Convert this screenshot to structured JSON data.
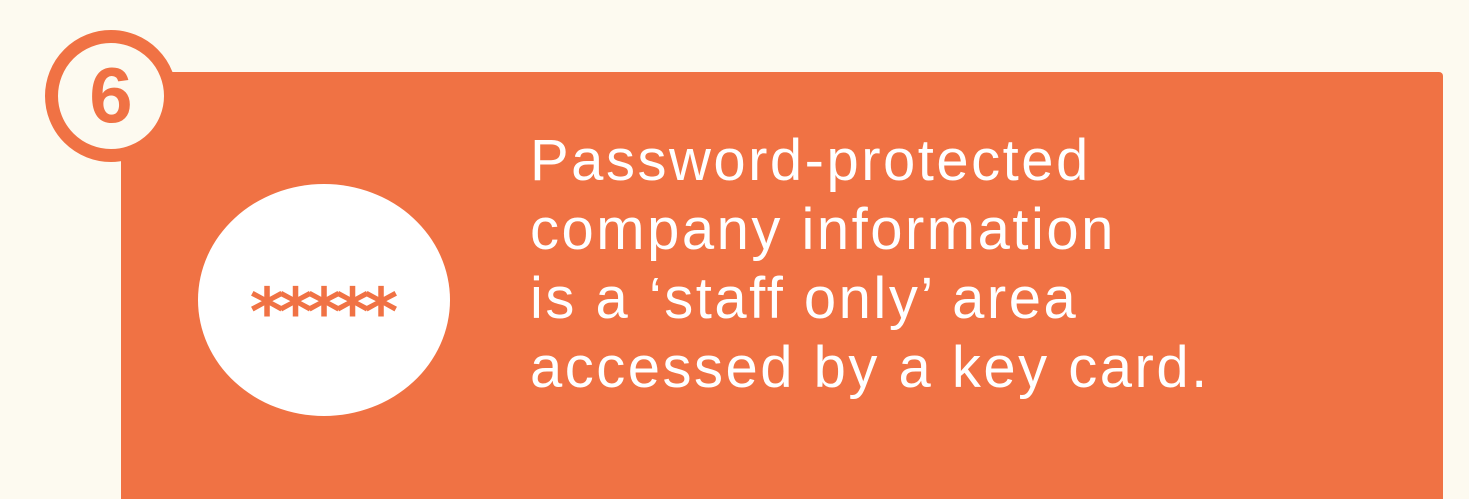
{
  "step": {
    "number": "6"
  },
  "icon": {
    "name": "password-mask-icon",
    "mask_text": "*****"
  },
  "message": {
    "lines": [
      "Password-protected",
      "company information",
      "is a ‘staff only’ area",
      "accessed by a key card."
    ]
  },
  "colors": {
    "accent": "#f07244",
    "background": "#fdfaf0",
    "text_on_accent": "#ffffff"
  }
}
